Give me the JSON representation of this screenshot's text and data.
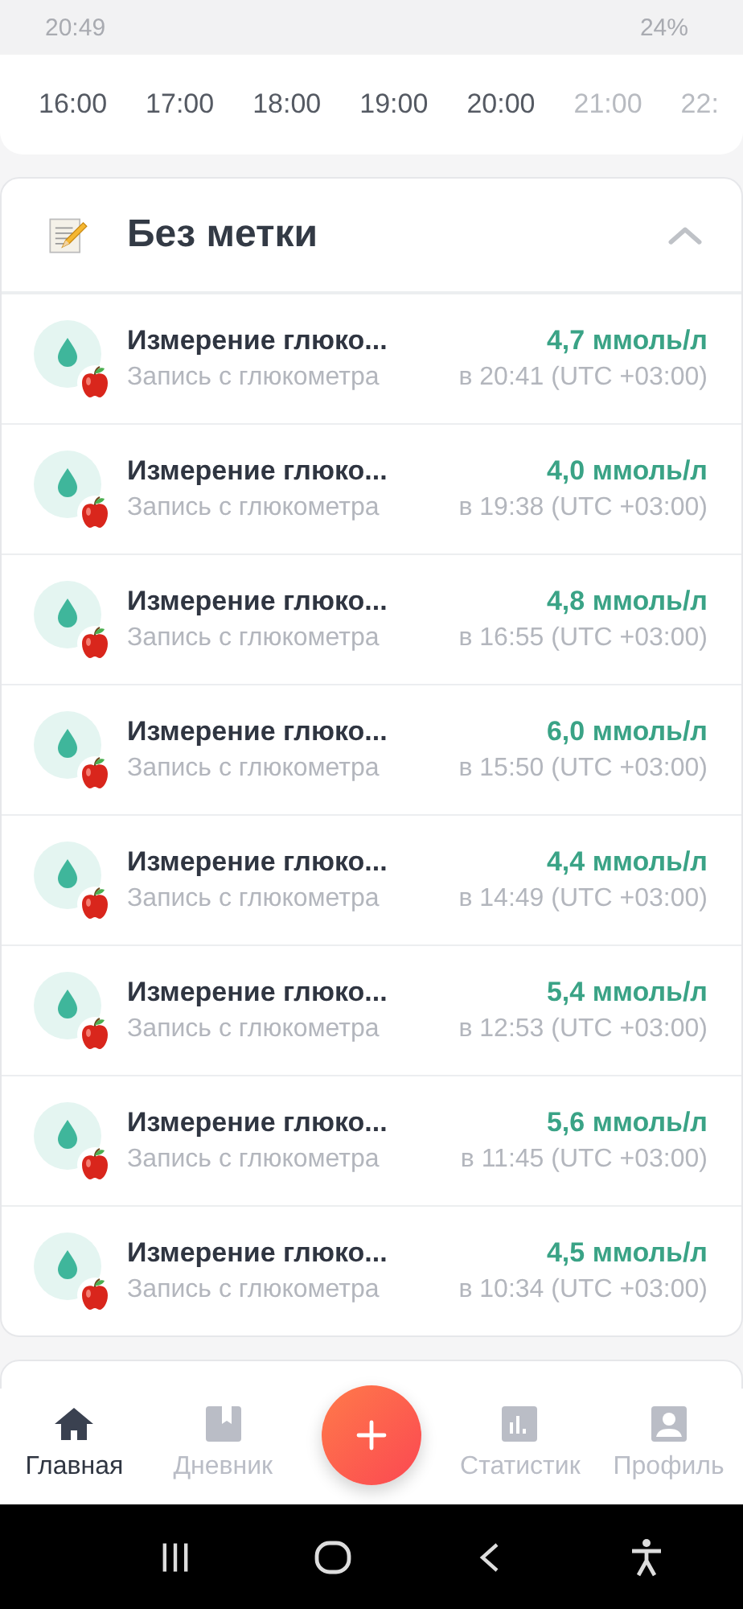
{
  "status_bar": {
    "time": "20:49",
    "battery": "24%"
  },
  "timeline": [
    {
      "label": "16:00",
      "dimmed": false
    },
    {
      "label": "17:00",
      "dimmed": false
    },
    {
      "label": "18:00",
      "dimmed": false
    },
    {
      "label": "19:00",
      "dimmed": false
    },
    {
      "label": "20:00",
      "dimmed": false
    },
    {
      "label": "21:00",
      "dimmed": true
    },
    {
      "label": "22:",
      "dimmed": true
    }
  ],
  "section": {
    "title": "Без метки",
    "expanded": true,
    "entries": [
      {
        "title": "Измерение глюко...",
        "subtitle": "Запись с глюкометра",
        "value": "4,7 ммоль/л",
        "time": "в 20:41 (UTC +03:00)"
      },
      {
        "title": "Измерение глюко...",
        "subtitle": "Запись с глюкометра",
        "value": "4,0 ммоль/л",
        "time": "в 19:38 (UTC +03:00)"
      },
      {
        "title": "Измерение глюко...",
        "subtitle": "Запись с глюкометра",
        "value": "4,8 ммоль/л",
        "time": "в 16:55 (UTC +03:00)"
      },
      {
        "title": "Измерение глюко...",
        "subtitle": "Запись с глюкометра",
        "value": "6,0 ммоль/л",
        "time": "в 15:50 (UTC +03:00)"
      },
      {
        "title": "Измерение глюко...",
        "subtitle": "Запись с глюкометра",
        "value": "4,4 ммоль/л",
        "time": "в 14:49 (UTC +03:00)"
      },
      {
        "title": "Измерение глюко...",
        "subtitle": "Запись с глюкометра",
        "value": "5,4 ммоль/л",
        "time": "в 12:53 (UTC +03:00)"
      },
      {
        "title": "Измерение глюко...",
        "subtitle": "Запись с глюкометра",
        "value": "5,6 ммоль/л",
        "time": "в 11:45 (UTC +03:00)"
      },
      {
        "title": "Измерение глюко...",
        "subtitle": "Запись с глюкометра",
        "value": "4,5 ммоль/л",
        "time": "в 10:34 (UTC +03:00)"
      }
    ]
  },
  "bottom_nav": [
    {
      "kind": "home",
      "label": "Главная",
      "selected": true
    },
    {
      "kind": "diary",
      "label": "Дневник",
      "selected": false
    },
    {
      "kind": "add"
    },
    {
      "kind": "stats",
      "label": "Статистик",
      "selected": false
    },
    {
      "kind": "profile",
      "label": "Профиль",
      "selected": false
    }
  ]
}
